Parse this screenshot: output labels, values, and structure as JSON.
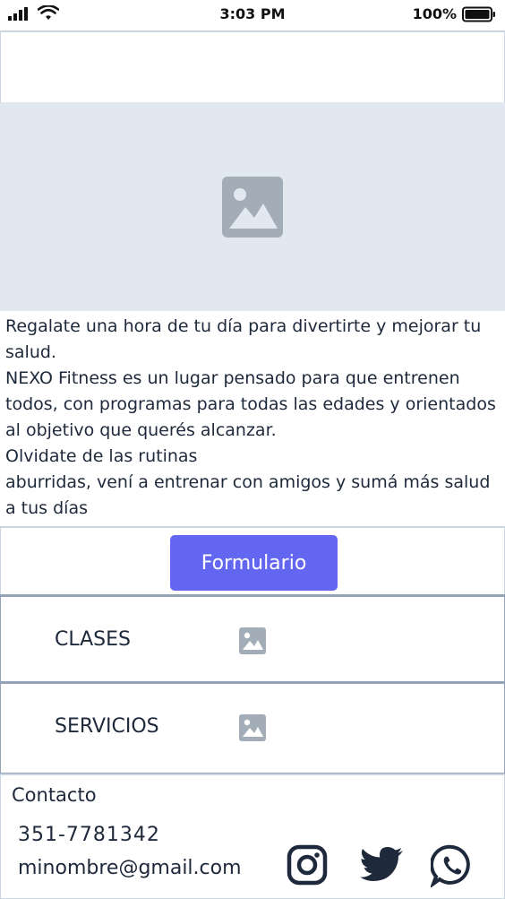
{
  "status_bar": {
    "time": "3:03 PM",
    "battery": "100%"
  },
  "hero": {
    "image_icon": "image-placeholder-icon"
  },
  "intro": {
    "lines": [
      "Regalate una hora de tu día para divertirte y mejorar tu salud.",
      "NEXO Fitness es un lugar pensado para que entrenen todos, con programas para todas las edades y orientados al objetivo que querés alcanzar.",
      "Olvidate de las rutinas",
      "aburridas, vení a entrenar con amigos y sumá más salud a tus días"
    ]
  },
  "form_button": {
    "label": "Formulario",
    "color": "#6366f1"
  },
  "sections": [
    {
      "label": "CLASES",
      "icon": "image-icon"
    },
    {
      "label": "SERVICIOS",
      "icon": "image-icon"
    }
  ],
  "contact": {
    "title": "Contacto",
    "phone": "351-7781342",
    "email": "minombre@gmail.com",
    "social": [
      "instagram-icon",
      "twitter-icon",
      "whatsapp-icon"
    ]
  }
}
